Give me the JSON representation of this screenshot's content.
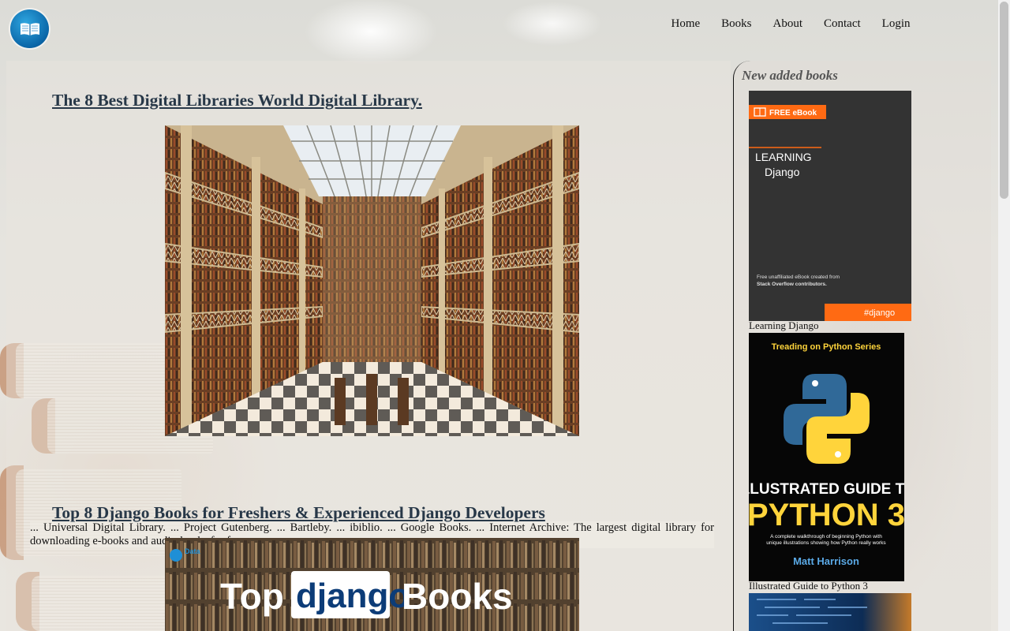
{
  "nav": {
    "home": "Home",
    "books": "Books",
    "about": "About",
    "contact": "Contact",
    "login": "Login"
  },
  "articles": [
    {
      "title": "The 8 Best Digital Libraries World Digital Library.",
      "excerpt": "... Universal Digital Library. ... Project Gutenberg. ... Bartleby. ... ibiblio. ... Google Books. ... Internet Archive: The largest digital library for downloading e-books and audio-books for free."
    },
    {
      "title": "Top 8 Django Books for Freshers & Experienced Django Developers",
      "image_text": {
        "brand": "Data",
        "top": "Top",
        "django": "django",
        "books": "Books"
      }
    }
  ],
  "sidebar": {
    "title": "New added books",
    "books": [
      {
        "caption": "Learning Django",
        "cover": {
          "badge": "FREE eBook",
          "line1": "LEARNING",
          "line2": "Django",
          "note1": "Free unaffiliated eBook created from",
          "note2": "Stack Overflow contributors.",
          "tag": "#django"
        }
      },
      {
        "caption": "Illustrated Guide to Python 3",
        "cover": {
          "series": "Treading on Python Series",
          "title1": "ILLUSTRATED GUIDE TO",
          "title2": "PYTHON 3",
          "blurb1": "A complete walkthrough of beginning Python with",
          "blurb2": "unique illustrations showing how Python really works",
          "author": "Matt Harrison"
        }
      }
    ]
  },
  "colors": {
    "link": "#283848",
    "orange": "#ff6a13",
    "python_yellow": "#ffd43b",
    "python_blue": "#306998"
  }
}
